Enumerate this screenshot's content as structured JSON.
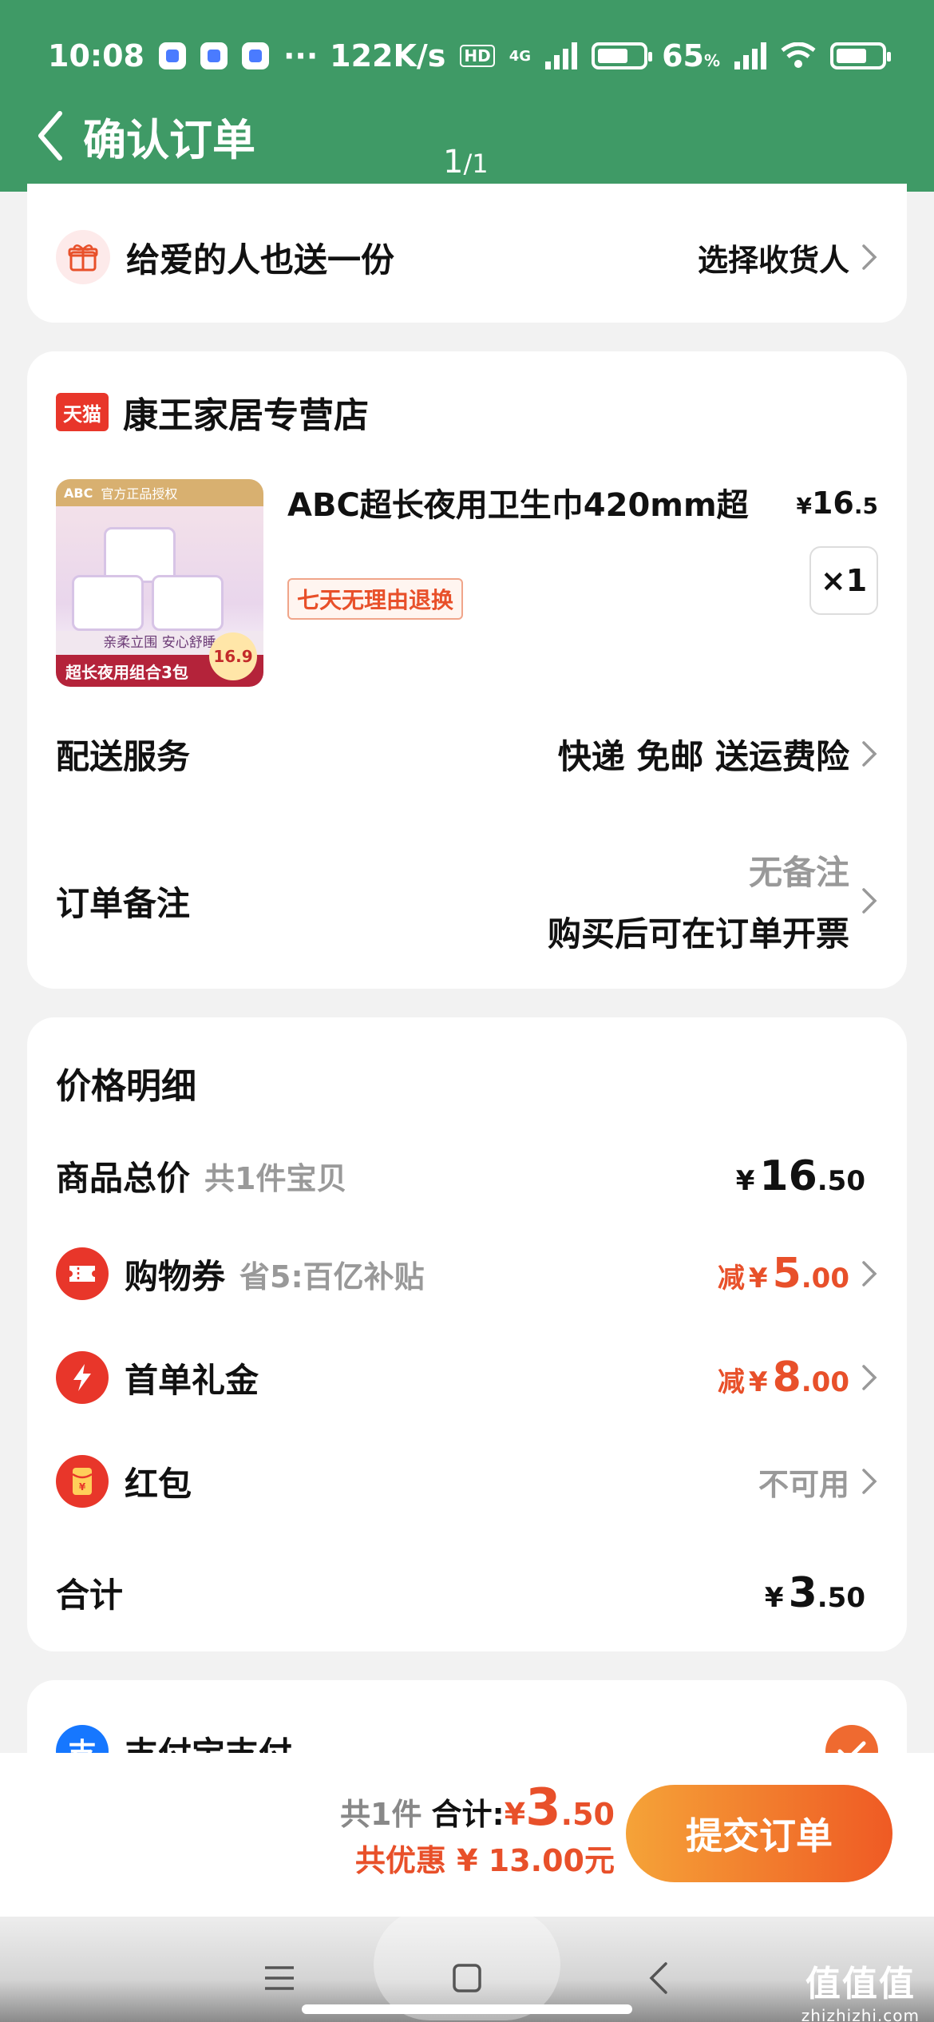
{
  "status_bar": {
    "time": "10:08",
    "network_speed": "122K/s",
    "hd_badge": "HD",
    "net_type": "4G",
    "battery": "65",
    "battery_unit": "%",
    "more": "···"
  },
  "header": {
    "title": "确认订单",
    "page_current": "1",
    "page_total": "/1"
  },
  "gift": {
    "label": "给爱的人也送一份",
    "action": "选择收货人"
  },
  "store": {
    "badge": "天猫",
    "name": "康王家居专营店",
    "product": {
      "title": "ABC超长夜用卫生巾420mm超",
      "price_symbol": "¥",
      "price_int": "16",
      "price_dec": ".5",
      "tag": "七天无理由退换",
      "quantity": "×1",
      "image": {
        "brand": "ABC",
        "auth": "官方正品授权",
        "slogan": "亲柔立围 安心舒睡",
        "banner": "超长夜用组合3包",
        "price": "16.9"
      }
    },
    "delivery": {
      "label": "配送服务",
      "value": "快递 免邮 送运费险"
    },
    "remark": {
      "label": "订单备注",
      "value_line1": "无备注",
      "value_line2": "购买后可在订单开票"
    }
  },
  "price_detail": {
    "title": "价格明细",
    "total": {
      "label": "商品总价",
      "sub": "共1件宝贝",
      "symbol": "¥",
      "int": "16",
      "dec": ".50"
    },
    "coupon": {
      "label": "购物券",
      "sub": "省5:百亿补贴",
      "prefix": "减",
      "symbol": "¥",
      "int": "5",
      "dec": ".00"
    },
    "first_order": {
      "label": "首单礼金",
      "prefix": "减",
      "symbol": "¥",
      "int": "8",
      "dec": ".00"
    },
    "red_packet": {
      "label": "红包",
      "value": "不可用"
    },
    "sum": {
      "label": "合计",
      "symbol": "¥",
      "int": "3",
      "dec": ".50"
    }
  },
  "payment": {
    "label": "支付宝支付"
  },
  "footer": {
    "count": "共1件",
    "sum_label": "合计:",
    "symbol": "¥",
    "int": "3",
    "dec": ".50",
    "discount": "共优惠 ¥ 13.00元",
    "submit": "提交订单"
  },
  "watermark": {
    "text": "值值值",
    "url": "zhizhizhi.com"
  },
  "colors": {
    "header_bg": "#3f9a66",
    "accent_red": "#e8502a",
    "button_gradient_start": "#f5a338",
    "button_gradient_end": "#ef5a24"
  }
}
